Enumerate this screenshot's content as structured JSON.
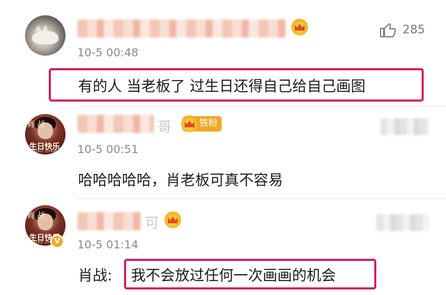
{
  "comments": [
    {
      "timestamp": "10-5 00:48",
      "text": "有的人 当老板了 过生日还得自己给自己画图",
      "likes": "285",
      "highlighted": true
    },
    {
      "timestamp": "10-5 00:51",
      "text": "哈哈哈哈哈，肖老板可真不容易",
      "badge": "铁粉",
      "name_tail": "哥",
      "avatar_text_top": "肖 战",
      "avatar_text_bottom": "生日快乐",
      "avatar_text_tiny": "XIAO ZHAN"
    },
    {
      "timestamp": "10-5 01:14",
      "speaker": "肖战:",
      "text": "我不会放过任何一次画画的机会",
      "name_tail": "可",
      "avatar_text_top": "肖 战",
      "avatar_text_bottom": "生日快乐",
      "avatar_text_tiny": "XIAO ZHAN",
      "verified_mark": "V",
      "highlighted": true
    }
  ],
  "colors": {
    "highlight_border": "#d81b60",
    "badge": "#f5a623",
    "timestamp": "#8a8a8a"
  },
  "icons": [
    "thumbs-up-icon",
    "crown-icon",
    "verified-icon"
  ]
}
